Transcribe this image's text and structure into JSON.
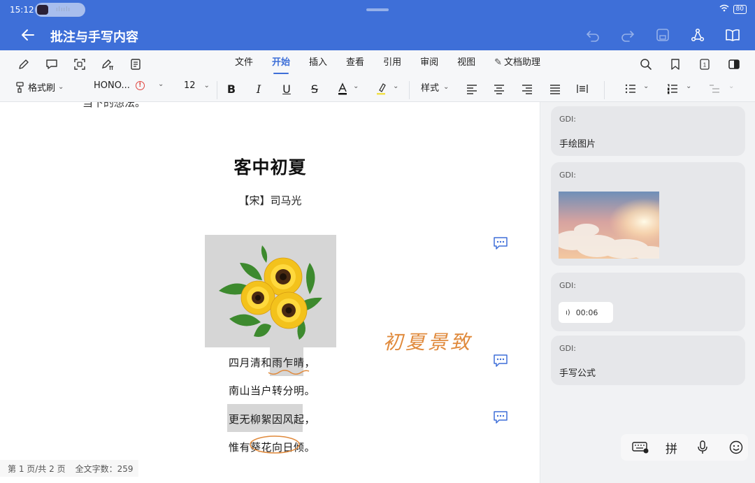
{
  "status": {
    "time": "15:12",
    "battery": "80"
  },
  "titlebar": {
    "title": "批注与手写内容"
  },
  "ribbon": {
    "tabs": [
      "文件",
      "开始",
      "插入",
      "查看",
      "引用",
      "审阅",
      "视图",
      "文档助理"
    ],
    "active_tab": "开始",
    "format_brush": "格式刷",
    "font_name": "HONO...",
    "font_size": "12",
    "style_label": "样式",
    "page_indicator": "1"
  },
  "document": {
    "cut_text": "当下的想法。",
    "poem_title": "客中初夏",
    "poem_author": "【宋】司马光",
    "lines": [
      "四月清和雨乍晴，",
      "南山当户转分明。",
      "更无柳絮因风起，",
      "惟有葵花向日倾。"
    ],
    "handwriting": "初夏景致"
  },
  "footer": {
    "page": "第 1 页/共 2 页",
    "word_count": "全文字数：259"
  },
  "comments": [
    {
      "author": "GDI:",
      "text": "手绘图片"
    },
    {
      "author": "GDI:",
      "text": ""
    },
    {
      "author": "GDI:",
      "text": "00:06"
    },
    {
      "author": "GDI:",
      "text": "手写公式"
    }
  ],
  "ime": {
    "pinyin": "拼"
  },
  "colors": {
    "accent": "#3e6fd8",
    "ink": "#e08a3c"
  }
}
